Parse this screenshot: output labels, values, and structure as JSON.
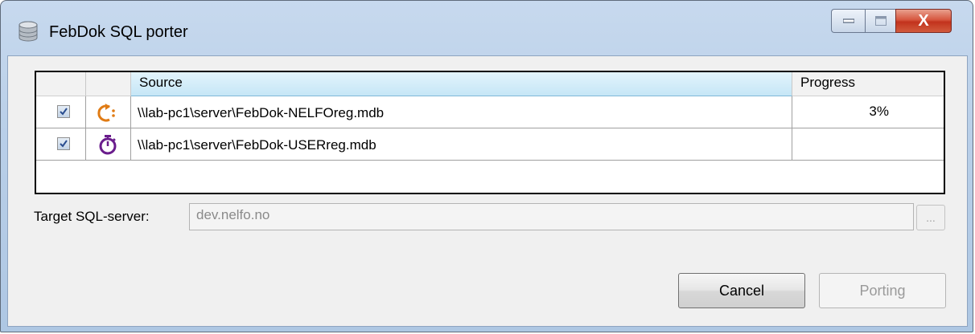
{
  "window": {
    "title": "FebDok SQL porter",
    "close_glyph": "X"
  },
  "grid": {
    "columns": [
      "",
      "",
      "Source",
      "Progress"
    ],
    "rows": [
      {
        "checked": true,
        "status_icon": "in-progress-icon",
        "source": "\\\\lab-pc1\\server\\FebDok-NELFOreg.mdb",
        "progress": "3%"
      },
      {
        "checked": true,
        "status_icon": "stopwatch-icon",
        "source": "\\\\lab-pc1\\server\\FebDok-USERreg.mdb",
        "progress": ""
      }
    ]
  },
  "target": {
    "label": "Target SQL-server:",
    "value": "dev.nelfo.no",
    "browse_label": "..."
  },
  "buttons": {
    "cancel": "Cancel",
    "porting": "Porting"
  },
  "colors": {
    "in_progress": "#e07b14",
    "stopwatch": "#6a1d8c",
    "check": "#2a4d8f"
  }
}
